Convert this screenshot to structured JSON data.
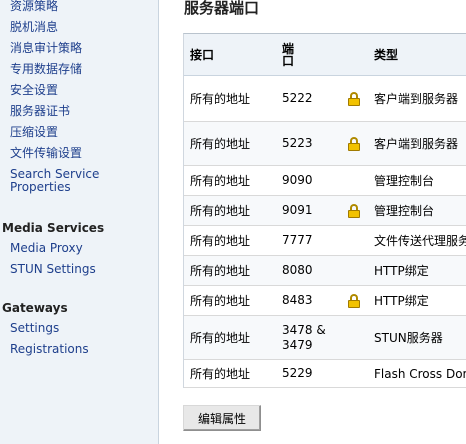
{
  "sidebar": {
    "items": [
      {
        "label": "资源策略"
      },
      {
        "label": "脱机消息"
      },
      {
        "label": "消息审计策略"
      },
      {
        "label": "专用数据存储"
      },
      {
        "label": "安全设置"
      },
      {
        "label": "服务器证书"
      },
      {
        "label": "压缩设置"
      },
      {
        "label": "文件传输设置"
      },
      {
        "label": "Search Service Properties"
      }
    ],
    "media_services": {
      "title": "Media Services",
      "items": [
        {
          "label": "Media Proxy"
        },
        {
          "label": "STUN Settings"
        }
      ]
    },
    "gateways": {
      "title": "Gateways",
      "items": [
        {
          "label": "Settings"
        },
        {
          "label": "Registrations"
        }
      ]
    }
  },
  "main": {
    "title": "服务器端口",
    "table": {
      "headers": {
        "interface": "接口",
        "port": "端口",
        "type": "类型"
      },
      "rows": [
        {
          "interface": "所有的地址",
          "port": "5222",
          "secure": true,
          "type": "客户端到服务器"
        },
        {
          "interface": "所有的地址",
          "port": "5223",
          "secure": true,
          "type": "客户端到服务器"
        },
        {
          "interface": "所有的地址",
          "port": "9090",
          "secure": false,
          "type": "管理控制台"
        },
        {
          "interface": "所有的地址",
          "port": "9091",
          "secure": true,
          "type": "管理控制台"
        },
        {
          "interface": "所有的地址",
          "port": "7777",
          "secure": false,
          "type": "文件传送代理服务"
        },
        {
          "interface": "所有的地址",
          "port": "8080",
          "secure": false,
          "type": "HTTP绑定"
        },
        {
          "interface": "所有的地址",
          "port": "8483",
          "secure": true,
          "type": "HTTP绑定"
        },
        {
          "interface": "所有的地址",
          "port": "3478 & 3479",
          "secure": false,
          "type": "STUN服务器"
        },
        {
          "interface": "所有的地址",
          "port": "5229",
          "secure": false,
          "type": "Flash Cross Domain"
        }
      ]
    },
    "edit_button": "编辑属性"
  }
}
